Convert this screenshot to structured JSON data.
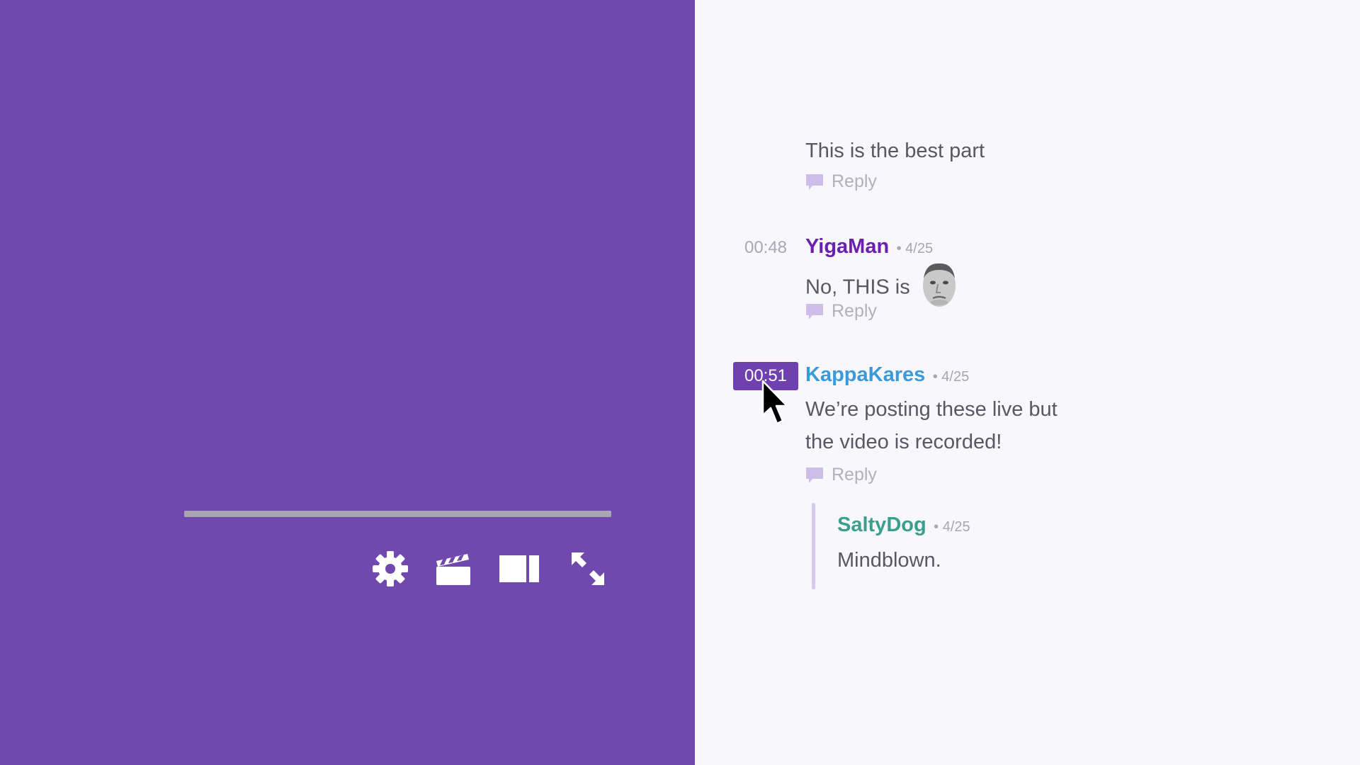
{
  "player": {
    "progress_fraction": 0,
    "controls": [
      {
        "name": "settings",
        "icon": "gear-icon"
      },
      {
        "name": "clip",
        "icon": "clapperboard-icon"
      },
      {
        "name": "theater-mode",
        "icon": "theater-mode-icon"
      },
      {
        "name": "fullscreen",
        "icon": "fullscreen-icon"
      }
    ]
  },
  "chat": {
    "comments": [
      {
        "timestamp": "",
        "username": "",
        "date": "",
        "message": "This is the best part",
        "reply_label": "Reply"
      },
      {
        "timestamp": "00:48",
        "username": "YigaMan",
        "username_color": "#6a1fb0",
        "date": "• 4/25",
        "message": "No, THIS is",
        "emote": "kappa-emote",
        "reply_label": "Reply"
      },
      {
        "timestamp": "00:51",
        "timestamp_active": true,
        "username": "KappaKares",
        "username_color": "#3a9ad9",
        "date": "• 4/25",
        "message_line1": "We’re posting these live but",
        "message_line2": "the video is recorded!",
        "reply_label": "Reply",
        "replies": [
          {
            "username": "SaltyDog",
            "username_color": "#3a9f8c",
            "date": "• 4/25",
            "message": "Mindblown."
          }
        ]
      }
    ]
  },
  "colors": {
    "video_bg": "#7049ae",
    "chat_bg": "#f8f7fc",
    "accent": "#6f41b0",
    "thread_line": "#d8c9ef"
  }
}
